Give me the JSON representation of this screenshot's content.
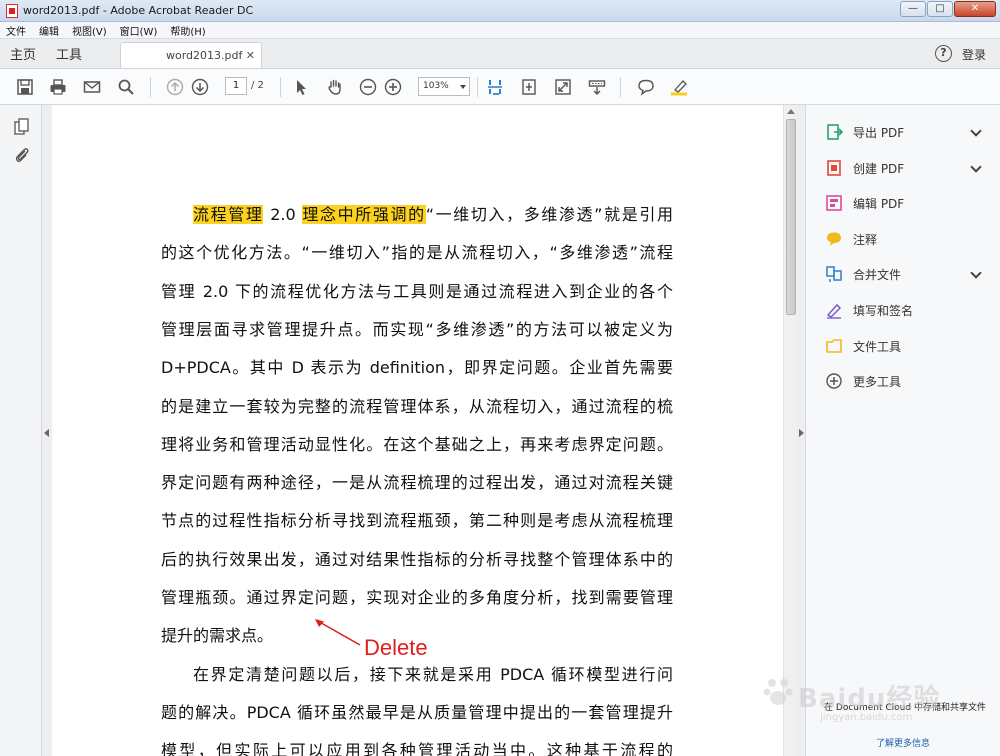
{
  "window": {
    "title": "word2013.pdf - Adobe Acrobat Reader DC",
    "controls": [
      "minimize",
      "maximize",
      "close"
    ]
  },
  "menu": {
    "items": [
      "文件",
      "编辑",
      "视图(V)",
      "窗口(W)",
      "帮助(H)"
    ]
  },
  "tabs": {
    "home": "主页",
    "tools": "工具",
    "document": "word2013.pdf",
    "login": "登录",
    "help": "?"
  },
  "toolbar": {
    "page_current": "1",
    "page_total": "/ 2",
    "zoom": "103%",
    "icons": [
      "save-icon",
      "print-icon",
      "email-icon",
      "search-icon",
      "prev-page-icon",
      "next-page-icon",
      "select-cursor-icon",
      "hand-tool-icon",
      "zoom-out-icon",
      "zoom-in-icon",
      "fit-width-icon",
      "fit-page-icon",
      "fullscreen-icon",
      "scroll-mode-icon",
      "comment-icon",
      "highlight-icon"
    ]
  },
  "document": {
    "lines": [
      {
        "segments": [
          {
            "text": "流程管理",
            "hl": true
          },
          {
            "text": " 2.0 ",
            "hl": false
          },
          {
            "text": "理念中所强调的",
            "hl": true
          },
          {
            "text": "“一维切入，多维渗透”就是引用",
            "hl": false
          }
        ],
        "indent": true
      },
      {
        "segments": [
          {
            "text": "的这个优化方法。“一维切入”指的是从流程切入，“多维渗透”流程",
            "hl": false
          }
        ]
      },
      {
        "segments": [
          {
            "text": "管理 2.0 下的流程优化方法与工具则是通过流程进入到企业的各个",
            "hl": false
          }
        ]
      },
      {
        "segments": [
          {
            "text": "管理层面寻求管理提升点。而实现“多维渗透”的方法可以被定义为",
            "hl": false
          }
        ]
      },
      {
        "segments": [
          {
            "text": "D+PDCA。其中 D 表示为 definition，即界定问题。企业首先需要",
            "hl": false
          }
        ]
      },
      {
        "segments": [
          {
            "text": "的是建立一套较为完整的流程管理体系，从流程切入，通过流程的梳",
            "hl": false
          }
        ]
      },
      {
        "segments": [
          {
            "text": "理将业务和管理活动显性化。在这个基础之上，再来考虑界定问题。",
            "hl": false
          }
        ]
      },
      {
        "segments": [
          {
            "text": "界定问题有两种途径，一是从流程梳理的过程出发，通过对流程关键",
            "hl": false
          }
        ]
      },
      {
        "segments": [
          {
            "text": "节点的过程性指标分析寻找到流程瓶颈，第二种则是考虑从流程梳理",
            "hl": false
          }
        ]
      },
      {
        "segments": [
          {
            "text": "后的执行效果出发，通过对结果性指标的分析寻找整个管理体系中的",
            "hl": false
          }
        ]
      },
      {
        "segments": [
          {
            "text": "管理瓶颈。通过界定问题，实现对企业的多角度分析，找到需要管理",
            "hl": false
          }
        ]
      },
      {
        "segments": [
          {
            "text": "提升的需求点。",
            "hl": false
          }
        ],
        "last": true
      },
      {
        "segments": [
          {
            "text": "在界定清楚问题以后，接下来就是采用 PDCA 循环模型进行问",
            "hl": false
          }
        ],
        "indent": true
      },
      {
        "segments": [
          {
            "text": "题的解决。PDCA 循环虽然最早是从质量管理中提出的一套管理提升",
            "hl": false
          }
        ]
      },
      {
        "segments": [
          {
            "text": "模型，但实际上可以应用到各种管理活动当中。这种基于流程的",
            "hl": false
          }
        ]
      }
    ],
    "annotation": {
      "label": "Delete",
      "color": "#e0201c"
    }
  },
  "tools_pane": {
    "items": [
      {
        "label": "导出 PDF",
        "icon": "export-pdf-icon",
        "expandable": true,
        "color": "#2aa36b"
      },
      {
        "label": "创建 PDF",
        "icon": "create-pdf-icon",
        "expandable": true,
        "color": "#e2493b"
      },
      {
        "label": "编辑 PDF",
        "icon": "edit-pdf-icon",
        "expandable": false,
        "color": "#d84fa0"
      },
      {
        "label": "注释",
        "icon": "comment-tool-icon",
        "expandable": false,
        "color": "#f2b91c"
      },
      {
        "label": "合并文件",
        "icon": "combine-files-icon",
        "expandable": true,
        "color": "#2f7fd0"
      },
      {
        "label": "填写和签名",
        "icon": "fill-sign-icon",
        "expandable": false,
        "color": "#7a5ec7"
      },
      {
        "label": "文件工具",
        "icon": "file-tools-icon",
        "expandable": false,
        "color": "#f0b823"
      },
      {
        "label": "更多工具",
        "icon": "more-tools-icon",
        "expandable": false,
        "color": "#555555"
      }
    ],
    "cloud_note": "在 Document Cloud 中存储和共享文件",
    "cloud_link": "了解更多信息"
  },
  "watermark": {
    "brand": "Baidu经验",
    "url": "jingyan.baidu.com"
  }
}
